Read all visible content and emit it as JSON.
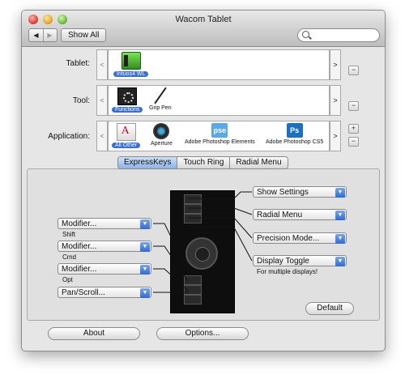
{
  "window": {
    "title": "Wacom Tablet"
  },
  "toolbar": {
    "back": "◀",
    "forward": "▶",
    "show_all": "Show All",
    "search_placeholder": ""
  },
  "rows": {
    "tablet": {
      "label": "Tablet:",
      "items": [
        {
          "caption": "Intuos4 WL",
          "icon": "tablet-icon",
          "selected": true
        }
      ]
    },
    "tool": {
      "label": "Tool:",
      "items": [
        {
          "caption": "Functions",
          "icon": "functions-icon",
          "selected": true
        },
        {
          "caption": "Grip Pen",
          "icon": "pen-icon",
          "selected": false
        }
      ]
    },
    "application": {
      "label": "Application:",
      "items": [
        {
          "caption": "All Other",
          "icon": "all-other-icon",
          "selected": true
        },
        {
          "caption": "Aperture",
          "icon": "aperture-icon",
          "selected": false
        },
        {
          "caption": "Adobe Photoshop Elements",
          "icon": "pse-icon",
          "icon_text": "pse",
          "selected": false
        },
        {
          "caption": "Adobe Photoshop CS5",
          "icon": "ps-icon",
          "icon_text": "Ps",
          "selected": false
        }
      ]
    }
  },
  "controls": {
    "left_arrow": "<",
    "right_arrow": ">",
    "minus": "−",
    "plus": "+"
  },
  "tabs": [
    {
      "label": "ExpressKeys",
      "active": true
    },
    {
      "label": "Touch Ring",
      "active": false
    },
    {
      "label": "Radial Menu",
      "active": false
    }
  ],
  "left_keys": [
    {
      "value": "Modifier...",
      "sub": "Shift"
    },
    {
      "value": "Modifier...",
      "sub": "Cmd"
    },
    {
      "value": "Modifier...",
      "sub": "Opt"
    },
    {
      "value": "Pan/Scroll...",
      "sub": ""
    }
  ],
  "right_keys": [
    {
      "value": "Show Settings",
      "sub": ""
    },
    {
      "value": "Radial Menu",
      "sub": ""
    },
    {
      "value": "Precision Mode...",
      "sub": ""
    },
    {
      "value": "Display Toggle",
      "sub": "For multiple displays!"
    }
  ],
  "buttons": {
    "default": "Default",
    "about": "About",
    "options": "Options..."
  },
  "colors": {
    "accent": "#3b6fd0",
    "popup_chevron": "#2f6bd1"
  }
}
